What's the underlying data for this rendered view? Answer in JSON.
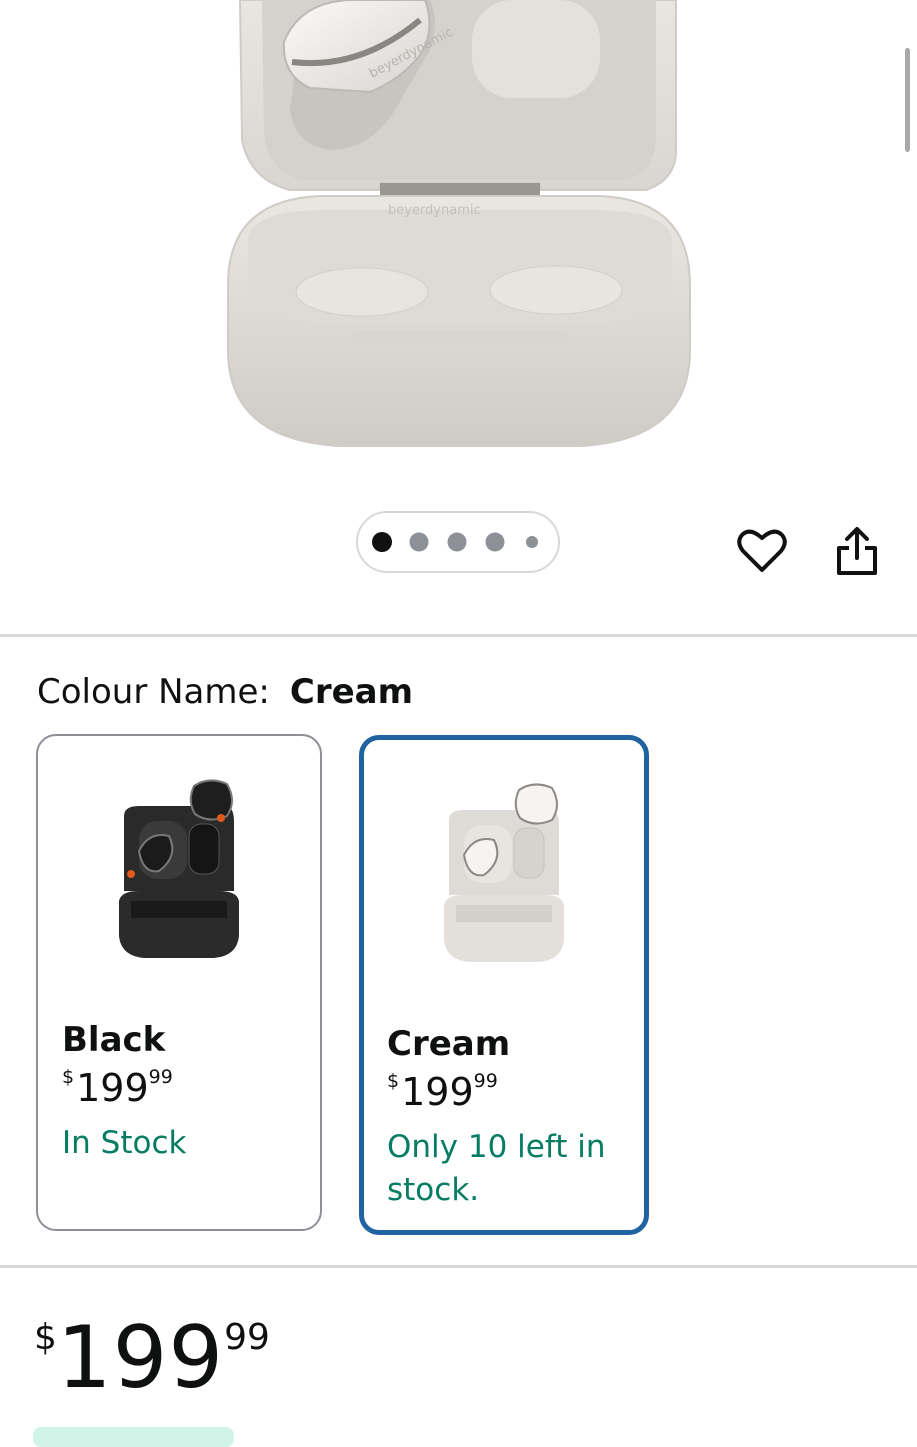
{
  "gallery": {
    "image_count": 5,
    "active_index": 0,
    "product_image": "earbuds-case-cream",
    "wishlist_icon": "heart-icon",
    "share_icon": "share-icon"
  },
  "variation": {
    "label": "Colour Name:",
    "selected_value": "Cream",
    "options": [
      {
        "name": "Black",
        "price_symbol": "$",
        "price_whole": "199",
        "price_fraction": "99",
        "availability": "In Stock",
        "image": "earbuds-case-black"
      },
      {
        "name": "Cream",
        "price_symbol": "$",
        "price_whole": "199",
        "price_fraction": "99",
        "availability": "Only 10 left in stock.",
        "image": "earbuds-case-cream"
      }
    ]
  },
  "buybox": {
    "price_symbol": "$",
    "price_whole": "199",
    "price_fraction": "99"
  },
  "colors": {
    "selected_border": "#2162a1",
    "stock_green": "#067d62",
    "divider": "#d5d9d9"
  }
}
